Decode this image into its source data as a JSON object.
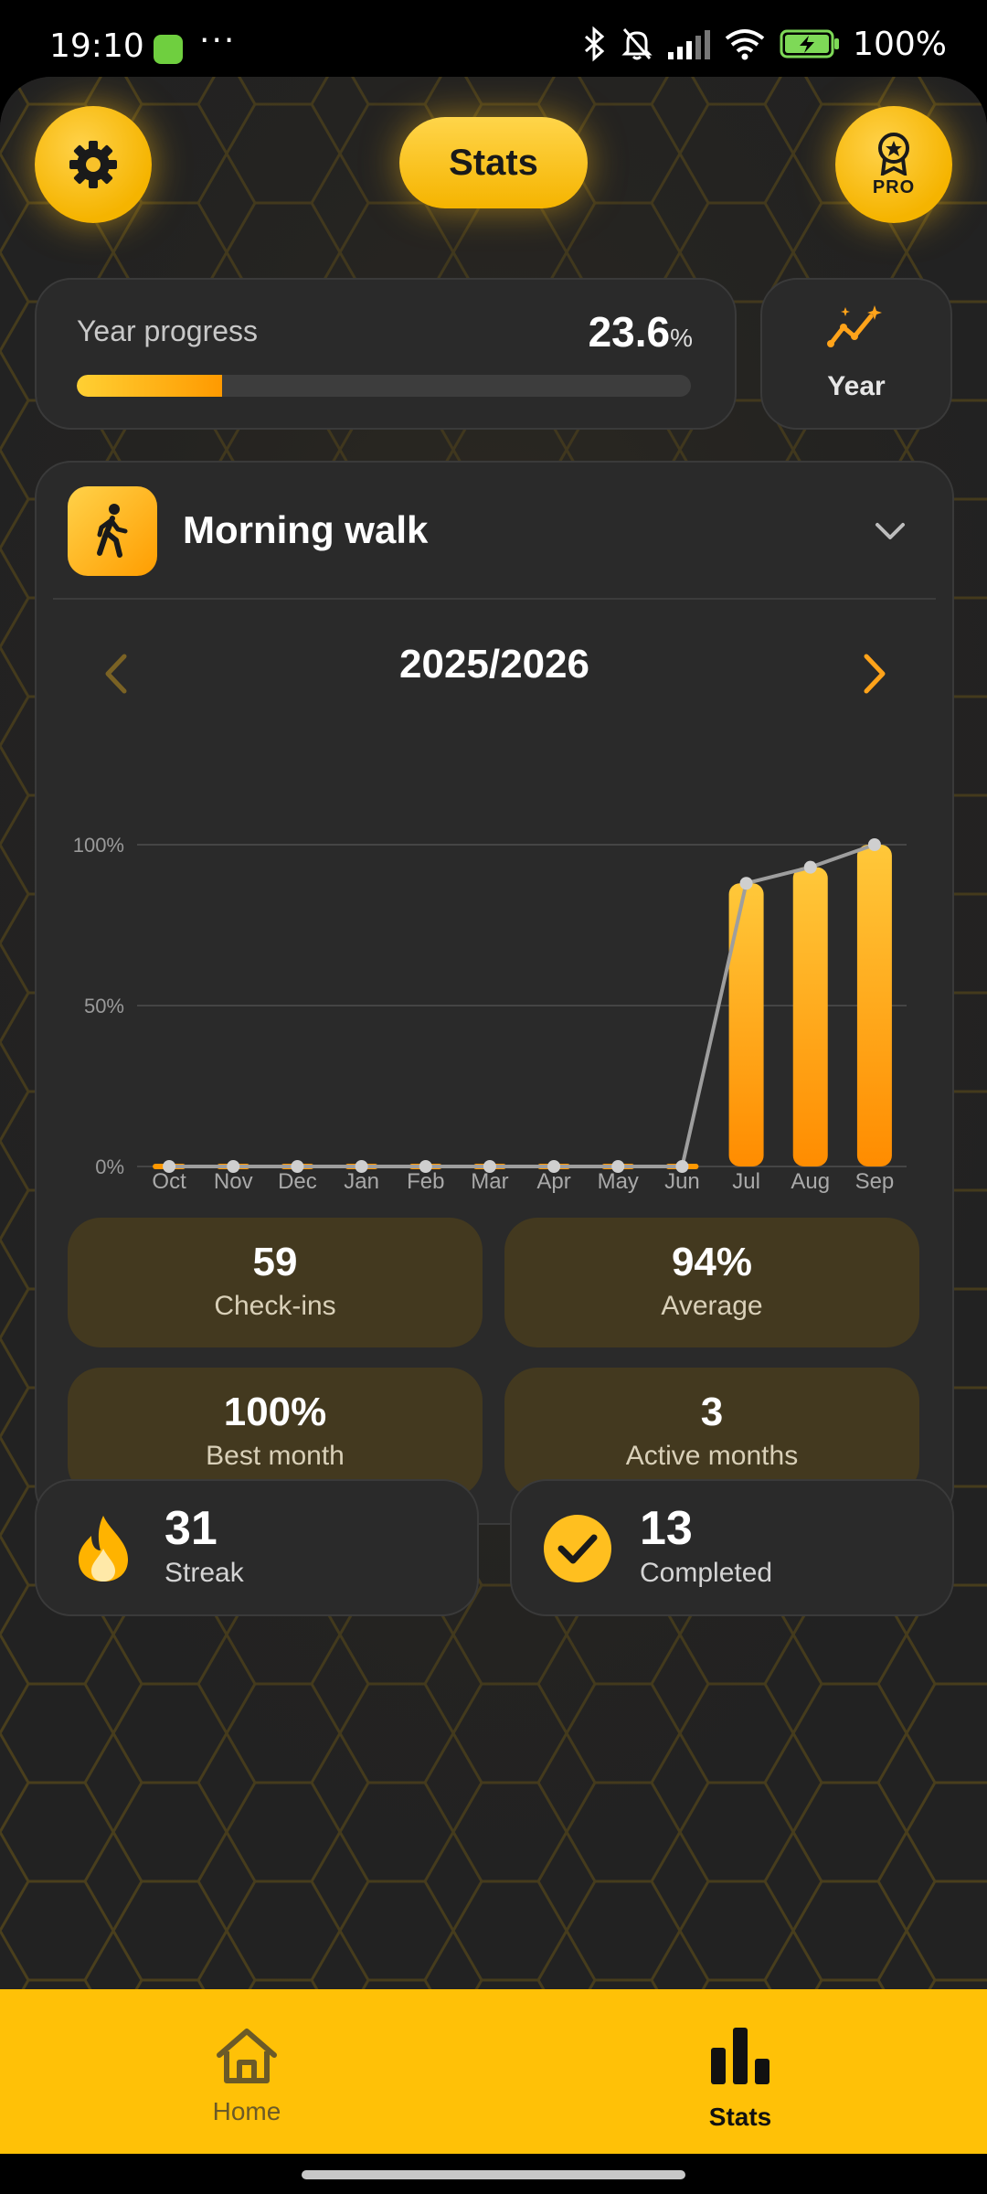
{
  "status_bar": {
    "time": "19:10",
    "battery": "100%",
    "notification_dots": "···"
  },
  "header": {
    "title": "Stats",
    "pro_badge": "PRO"
  },
  "year_progress": {
    "label": "Year progress",
    "value": "23.6",
    "unit": "%",
    "fraction": 0.236
  },
  "view_toggle": {
    "label": "Year"
  },
  "habit": {
    "name": "Morning walk",
    "period": "2025/2026"
  },
  "chart_data": {
    "type": "bar",
    "categories": [
      "Oct",
      "Nov",
      "Dec",
      "Jan",
      "Feb",
      "Mar",
      "Apr",
      "May",
      "Jun",
      "Jul",
      "Aug",
      "Sep"
    ],
    "values": [
      0,
      0,
      0,
      0,
      0,
      0,
      0,
      0,
      0,
      88,
      93,
      100
    ],
    "ylim": [
      0,
      100
    ],
    "yticks": [
      "100%",
      "50%",
      "0%"
    ],
    "grid": true,
    "overlay": "line"
  },
  "stats": [
    {
      "value": "59",
      "label": "Check-ins"
    },
    {
      "value": "94%",
      "label": "Average"
    },
    {
      "value": "100%",
      "label": "Best month"
    },
    {
      "value": "3",
      "label": "Active months"
    }
  ],
  "streak": {
    "value": "31",
    "label": "Streak"
  },
  "completed": {
    "value": "13",
    "label": "Completed"
  },
  "nav": {
    "home": "Home",
    "stats": "Stats"
  },
  "colors": {
    "accent": "#ffc107",
    "tile": "#43391f",
    "card": "#2a2a2a"
  }
}
